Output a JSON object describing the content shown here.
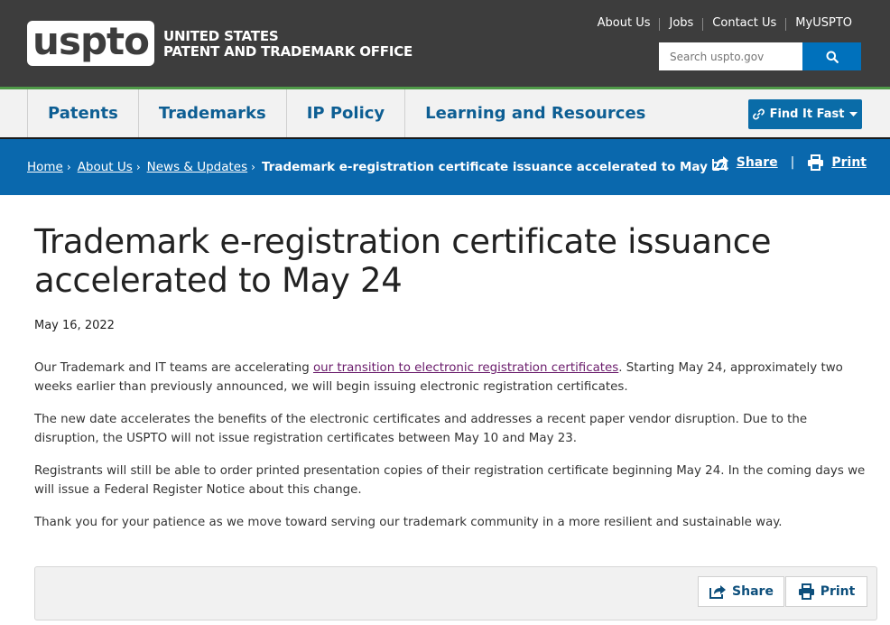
{
  "header": {
    "logo": "uspto",
    "agency_line1": "UNITED STATES",
    "agency_line2": "PATENT AND TRADEMARK OFFICE",
    "util_links": [
      "About Us",
      "Jobs",
      "Contact Us",
      "MyUSPTO"
    ],
    "search_placeholder": "Search uspto.gov"
  },
  "mainnav": {
    "items": [
      "Patents",
      "Trademarks",
      "IP Policy",
      "Learning and Resources"
    ],
    "find_it_fast": "Find It Fast"
  },
  "breadcrumb": {
    "items": [
      "Home",
      "About Us",
      "News & Updates"
    ],
    "current": "Trademark e-registration certificate issuance accelerated to May 24",
    "share": "Share",
    "print": "Print",
    "separator": "|"
  },
  "article": {
    "title": "Trademark e-registration certificate issuance accelerated to May 24",
    "date": "May 16, 2022",
    "p1_before": "Our Trademark and IT teams are accelerating ",
    "p1_link": "our transition to electronic registration certificates",
    "p1_after": ". Starting May 24, approximately two weeks earlier than previously announced, we will begin issuing electronic registration certificates.",
    "p2": "The new date accelerates the benefits of the electronic certificates and addresses a recent paper vendor disruption. Due to the disruption, the USPTO will not issue registration certificates between May 10 and May 23.",
    "p3": "Registrants will still be able to order printed presentation copies of their registration certificate beginning May 24. In the coming days we will issue a Federal Register Notice about this change.",
    "p4": "Thank you for your patience as we move toward serving our trademark community in a more resilient and sustainable way."
  },
  "footer_tools": {
    "share": "Share",
    "print": "Print"
  },
  "colors": {
    "header_bg": "#3d3d3d",
    "accent_blue": "#0071bc",
    "crumb_bar": "#0a68ad",
    "nav_text": "#0d5e93",
    "green_line": "#4f9a48",
    "visited_link": "#6a1b6b"
  }
}
